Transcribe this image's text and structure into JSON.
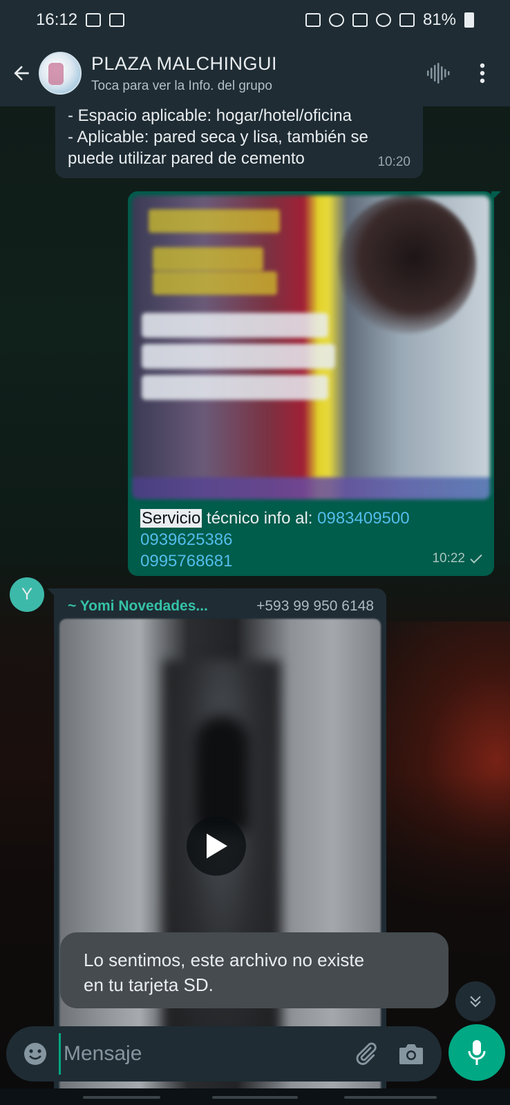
{
  "status_bar": {
    "time": "16:12",
    "battery": "81%"
  },
  "header": {
    "group_name": "PLAZA MALCHINGUI",
    "subtitle": "Toca para ver la Info. del grupo"
  },
  "messages": {
    "m1": {
      "line1": "- Espacio aplicable: hogar/hotel/oficina",
      "line2": "- Aplicable: pared seca y lisa, también se",
      "line3": "puede utilizar pared de cemento",
      "time": "10:20"
    },
    "m2": {
      "highlight": "Servicio",
      "text": " técnico info al: ",
      "phone1": "0983409500",
      "phone2": "0939625386",
      "phone3": "0995768681",
      "time": "10:22",
      "status": "sent"
    },
    "m3": {
      "avatar_letter": "Y",
      "sender_name": "~ Yomi Novedades...",
      "sender_phone": "+593 99 950 6148"
    }
  },
  "toast": {
    "line1": "Lo sentimos, este archivo no existe",
    "line2": "en tu tarjeta SD."
  },
  "composer": {
    "placeholder": "Mensaje"
  },
  "colors": {
    "accent": "#00a884",
    "outgoing_bubble": "#005c4b",
    "incoming_bubble": "#1f2c34",
    "link": "#53bdeb"
  },
  "icons": {
    "back": "arrow-left-icon",
    "voice_call": "audio-wave-icon",
    "menu": "more-vertical-icon",
    "play": "play-icon",
    "scroll": "chevron-double-down-icon",
    "emoji": "emoji-icon",
    "attach": "paperclip-icon",
    "camera": "camera-icon",
    "mic": "microphone-icon"
  }
}
